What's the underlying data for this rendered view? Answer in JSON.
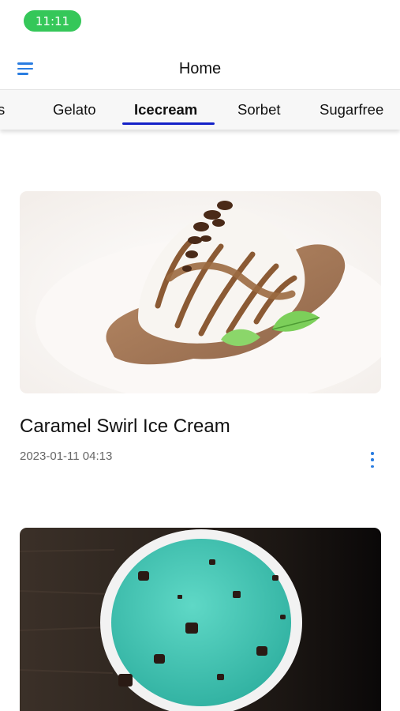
{
  "status_bar": {
    "time": "11:11"
  },
  "header": {
    "title": "Home",
    "menu_icon": "hamburger-menu-icon"
  },
  "tabs": [
    {
      "label": "s"
    },
    {
      "label": "Gelato"
    },
    {
      "label": "Icecream",
      "active": true
    },
    {
      "label": "Sorbet"
    },
    {
      "label": "Sugarfree"
    }
  ],
  "colors": {
    "accent": "#2a7de1",
    "tab_indicator": "#1422c8",
    "status_pill": "#35c759"
  },
  "feed": {
    "items": [
      {
        "title": "Caramel Swirl Ice Cream",
        "date": "2023-01-11 04:13",
        "image": "caramel-swirl-ice-cream-photo",
        "more_icon": "more-vertical-icon"
      },
      {
        "image": "mint-chocolate-chip-ice-cream-photo"
      }
    ]
  }
}
